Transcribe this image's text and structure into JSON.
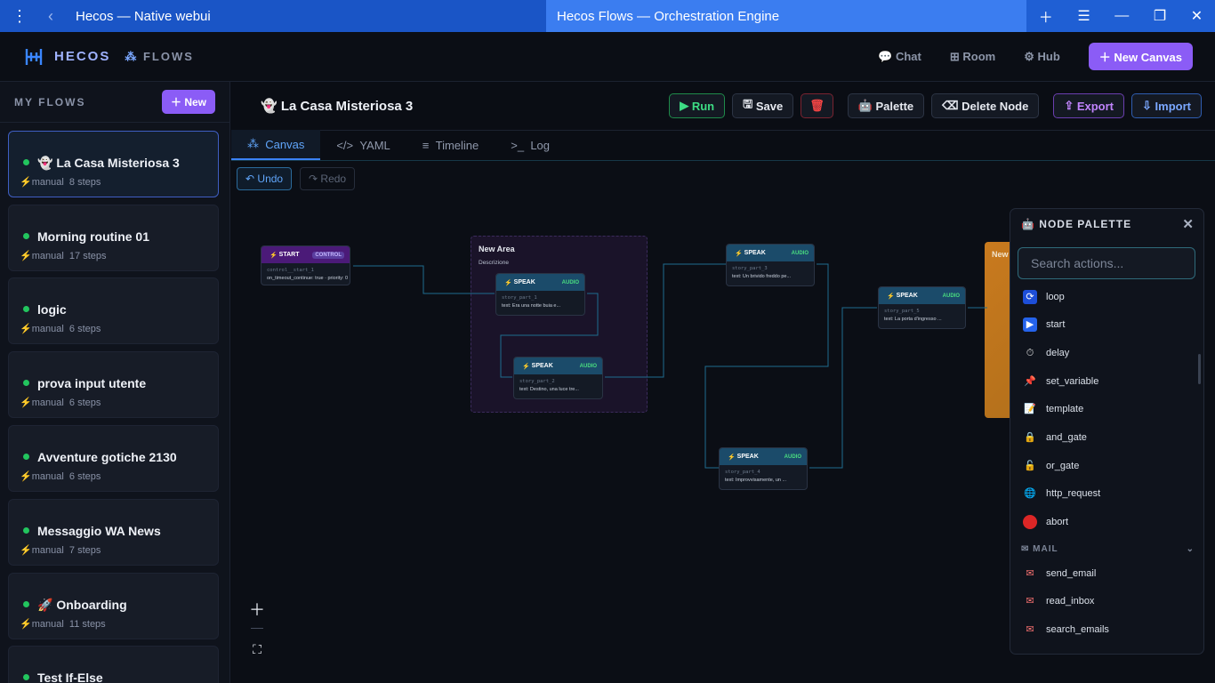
{
  "window": {
    "title": "Hecos — Native webui",
    "tab": "Hecos Flows — Orchestration Engine"
  },
  "topbar": {
    "brand": "HECOS",
    "section": "FLOWS",
    "nav": [
      "Chat",
      "Room",
      "Hub"
    ],
    "new_canvas": "New Canvas"
  },
  "sidebar": {
    "title": "MY FLOWS",
    "new": "New",
    "flows": [
      {
        "name": "La Casa Misteriosa 3",
        "icon": "👻",
        "trigger": "manual",
        "steps": "8 steps"
      },
      {
        "name": "Morning routine 01",
        "icon": "",
        "trigger": "manual",
        "steps": "17 steps"
      },
      {
        "name": "logic",
        "icon": "",
        "trigger": "manual",
        "steps": "6 steps"
      },
      {
        "name": "prova input utente",
        "icon": "",
        "trigger": "manual",
        "steps": "6 steps"
      },
      {
        "name": "Avventure gotiche 2130",
        "icon": "",
        "trigger": "manual",
        "steps": "6 steps"
      },
      {
        "name": "Messaggio WA News",
        "icon": "",
        "trigger": "manual",
        "steps": "7 steps"
      },
      {
        "name": "Onboarding",
        "icon": "🚀",
        "trigger": "manual",
        "steps": "11 steps"
      },
      {
        "name": "Test If-Else",
        "icon": "",
        "trigger": "",
        "steps": ""
      }
    ]
  },
  "canvas_header": {
    "title": "La Casa Misteriosa 3",
    "icon": "👻",
    "buttons": {
      "run": "Run",
      "save": "Save",
      "palette": "Palette",
      "delete_node": "Delete Node",
      "export": "Export",
      "import": "Import"
    }
  },
  "tabs": [
    "Canvas",
    "YAML",
    "Timeline",
    "Log"
  ],
  "undo": "Undo",
  "redo": "Redo",
  "area": {
    "title": "New Area",
    "desc": "Descrizione"
  },
  "area2": {
    "title": "New"
  },
  "nodes": [
    {
      "id": "start",
      "type": "START",
      "badge": "CONTROL",
      "l1": "control__start_1",
      "l2": "on_timeout_continue: true · priority: 0"
    },
    {
      "id": "s1",
      "type": "SPEAK",
      "badge": "AUDIO",
      "l1": "story_part_1",
      "l2": "text: Era una notte buia e..."
    },
    {
      "id": "s2",
      "type": "SPEAK",
      "badge": "AUDIO",
      "l1": "story_part_2",
      "l2": "text: Destino, una luce tre..."
    },
    {
      "id": "s3",
      "type": "SPEAK",
      "badge": "AUDIO",
      "l1": "story_part_3",
      "l2": "text: Un brivido freddo pe..."
    },
    {
      "id": "s4",
      "type": "SPEAK",
      "badge": "AUDIO",
      "l1": "story_part_4",
      "l2": "text: Improvvisamente, un ..."
    },
    {
      "id": "s5",
      "type": "SPEAK",
      "badge": "AUDIO",
      "l1": "story_part_5",
      "l2": "text: La porta d'ingresso ..."
    }
  ],
  "palette": {
    "title": "NODE PALETTE",
    "placeholder": "Search actions...",
    "items": [
      "loop",
      "start",
      "delay",
      "set_variable",
      "template",
      "and_gate",
      "or_gate",
      "http_request",
      "abort"
    ],
    "section": "MAIL",
    "mail_items": [
      "send_email",
      "read_inbox",
      "search_emails"
    ]
  }
}
